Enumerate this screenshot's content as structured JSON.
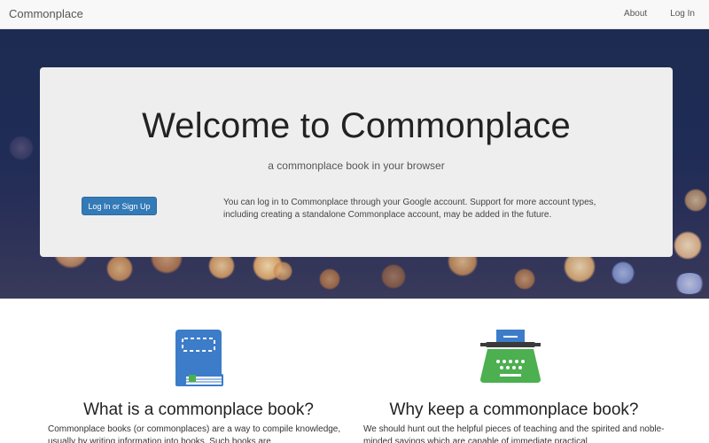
{
  "navbar": {
    "brand": "Commonplace",
    "links": [
      {
        "label": "About"
      },
      {
        "label": "Log In"
      }
    ]
  },
  "hero": {
    "title": "Welcome to Commonplace",
    "subtitle": "a commonplace book in your browser",
    "login_button": "Log In or Sign Up",
    "info": "You can log in to Commonplace through your Google account. Support for more account types, including creating a standalone Commonplace account, may be added in the future."
  },
  "features": [
    {
      "icon": "book-icon",
      "title": "What is a commonplace book?",
      "text": "Commonplace books (or commonplaces) are a way to compile knowledge, usually by writing information into books. Such books are"
    },
    {
      "icon": "typewriter-icon",
      "title": "Why keep a commonplace book?",
      "text": "We should hunt out the helpful pieces of teaching and the spirited and noble-minded sayings which are capable of immediate practical"
    }
  ],
  "colors": {
    "primary": "#337ab7",
    "book_icon": "#3d7cc9",
    "typewriter_icon": "#4caf50"
  }
}
